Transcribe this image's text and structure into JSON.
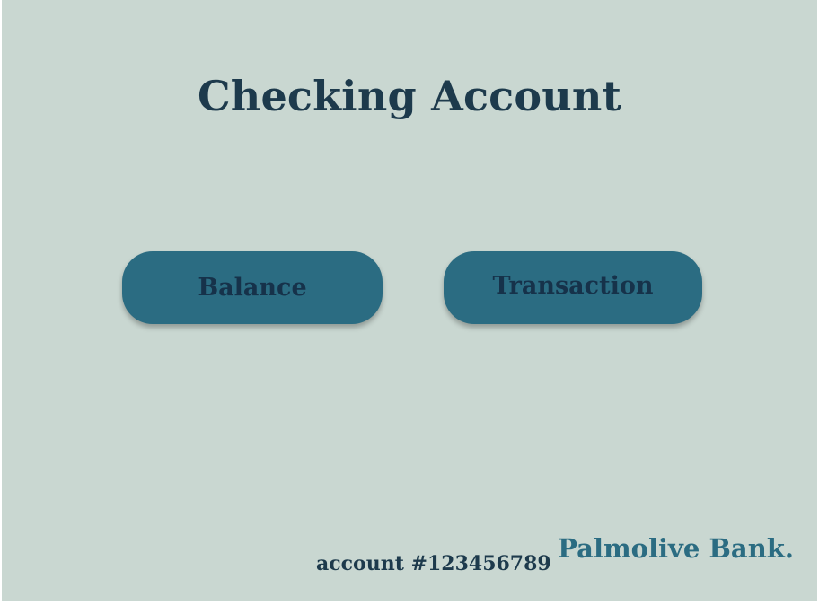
{
  "header": {
    "title": "Checking Account"
  },
  "actions": {
    "balance_label": "Balance",
    "transaction_label": "Transaction"
  },
  "footer": {
    "account_number": "account #123456789",
    "brand": "Palmolive Bank."
  },
  "colors": {
    "background": "#c9d7d1",
    "button": "#2b6c82",
    "title_text": "#1d3a4c",
    "brand_text": "#2b6c82"
  }
}
